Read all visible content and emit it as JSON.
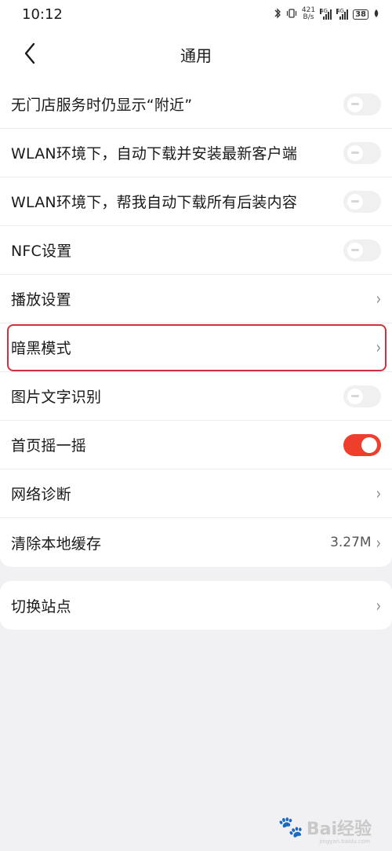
{
  "status_bar": {
    "time": "10:12",
    "net_speed_value": "421",
    "net_speed_unit": "B/s",
    "signal1_label": "4G",
    "signal2_label": "4G",
    "battery": "38",
    "bluetooth_icon": "bluetooth-icon",
    "vibrate_icon": "vibrate-icon"
  },
  "header": {
    "title": "通用",
    "back_icon": "chevron-left-icon"
  },
  "settings": {
    "items": [
      {
        "label": "无门店服务时仍显示“附近”",
        "control": "toggle",
        "on": false
      },
      {
        "label": "WLAN环境下，自动下载并安装最新客户端",
        "control": "toggle",
        "on": false
      },
      {
        "label": "WLAN环境下，帮我自动下载所有后装内容",
        "control": "toggle",
        "on": false
      },
      {
        "label": "NFC设置",
        "control": "toggle",
        "on": false
      },
      {
        "label": "播放设置",
        "control": "chevron"
      },
      {
        "label": "暗黑模式",
        "control": "chevron",
        "highlighted": true
      },
      {
        "label": "图片文字识别",
        "control": "toggle",
        "on": false
      },
      {
        "label": "首页摇一摇",
        "control": "toggle",
        "on": true
      },
      {
        "label": "网络诊断",
        "control": "chevron"
      },
      {
        "label": "清除本地缓存",
        "control": "chevron",
        "value": "3.27M"
      }
    ]
  },
  "site": {
    "label": "切换站点",
    "control": "chevron"
  },
  "chevron_glyph": "›",
  "colors": {
    "accent": "#ee3f2c",
    "highlight_border": "#d0303a",
    "background": "#f1f1f3"
  },
  "watermark": {
    "text": "Bai经验",
    "sub": "jingyan.baidu.com"
  }
}
